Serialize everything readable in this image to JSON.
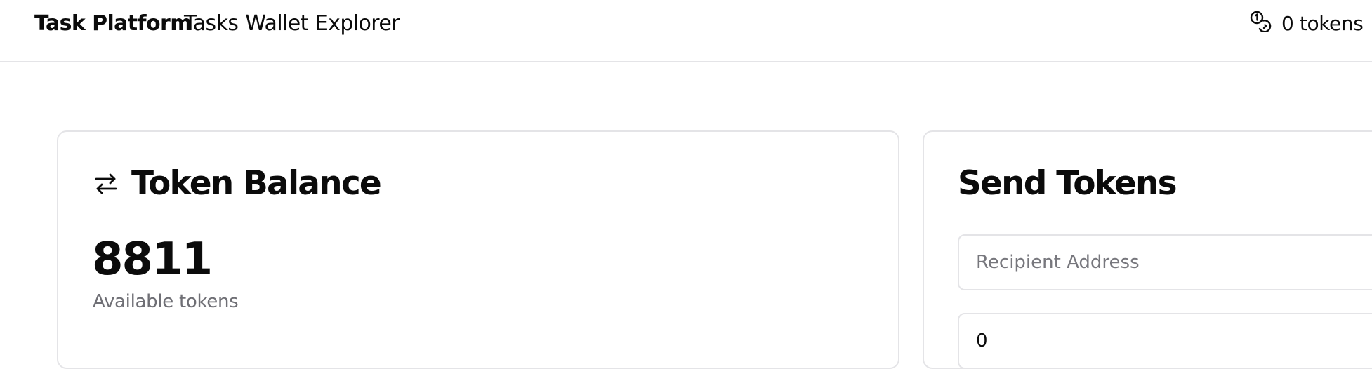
{
  "header": {
    "brand": "Task Platform",
    "nav": [
      {
        "label": "Tasks"
      },
      {
        "label": "Wallet"
      },
      {
        "label": "Explorer"
      }
    ],
    "balance_label": "0 tokens",
    "balance_icon": "coins-icon"
  },
  "balance_card": {
    "title": "Token Balance",
    "icon": "arrows-left-right-icon",
    "value": "8811",
    "caption": "Available tokens"
  },
  "send_card": {
    "title": "Send Tokens",
    "recipient_placeholder": "Recipient Address",
    "amount_value": "0"
  }
}
